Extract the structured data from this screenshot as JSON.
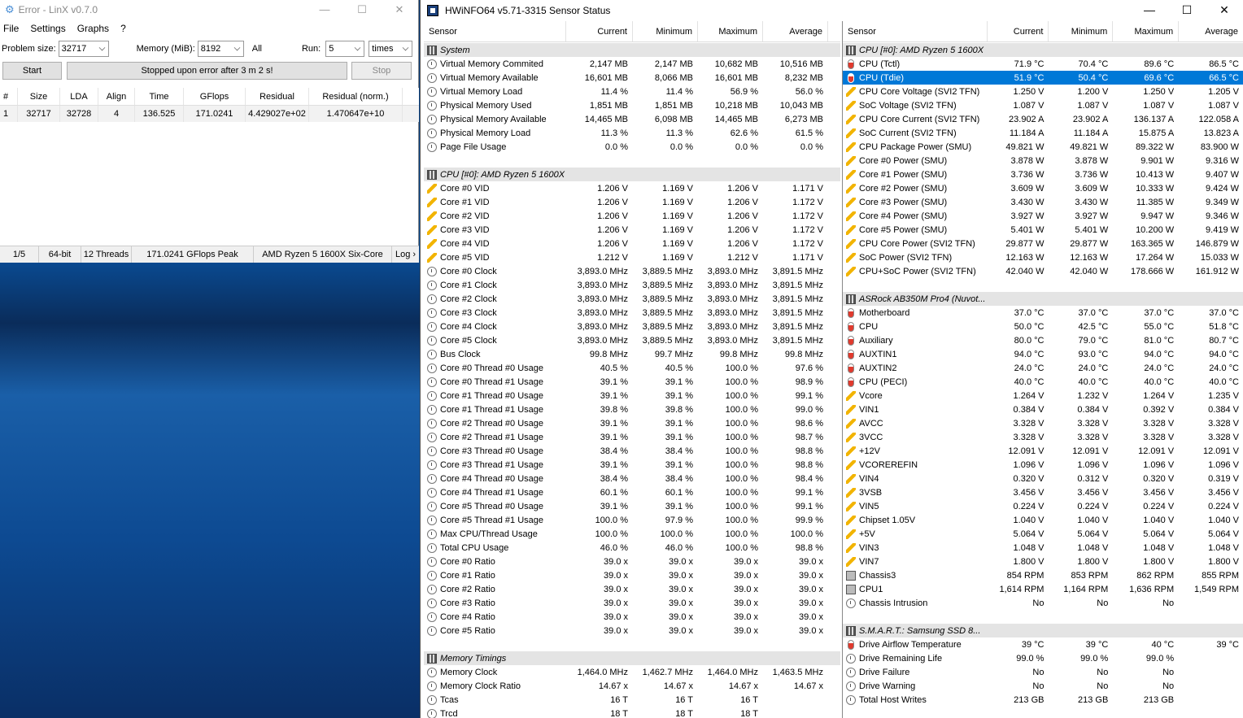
{
  "linx": {
    "title": "Error - LinX v0.7.0",
    "menu": [
      "File",
      "Settings",
      "Graphs",
      "?"
    ],
    "problem_size_label": "Problem size:",
    "problem_size_value": "32717",
    "memory_label": "Memory (MiB):",
    "memory_value": "8192",
    "all_label": "All",
    "run_label": "Run:",
    "run_value": "5",
    "run_unit": "times",
    "start_label": "Start",
    "status_message": "Stopped upon error after 3 m 2 s!",
    "stop_label": "Stop",
    "columns": [
      "#",
      "Size",
      "LDA",
      "Align",
      "Time",
      "GFlops",
      "Residual",
      "Residual (norm.)"
    ],
    "rows": [
      [
        "1",
        "32717",
        "32728",
        "4",
        "136.525",
        "171.0241",
        "4.429027e+02",
        "1.470647e+10"
      ]
    ],
    "statusbar": [
      "1/5",
      "64-bit",
      "12 Threads",
      "171.0241 GFlops Peak",
      "AMD Ryzen 5 1600X Six-Core",
      "Log ›"
    ]
  },
  "hwinfo": {
    "title": "HWiNFO64 v5.71-3315 Sensor Status",
    "columns": [
      "Sensor",
      "Current",
      "Minimum",
      "Maximum",
      "Average"
    ],
    "left_rows": [
      {
        "t": "group",
        "icon": "grp",
        "name": "System"
      },
      {
        "icon": "clock",
        "name": "Virtual Memory Commited",
        "c": "2,147 MB",
        "mn": "2,147 MB",
        "mx": "10,682 MB",
        "av": "10,516 MB"
      },
      {
        "icon": "clock",
        "name": "Virtual Memory Available",
        "c": "16,601 MB",
        "mn": "8,066 MB",
        "mx": "16,601 MB",
        "av": "8,232 MB"
      },
      {
        "icon": "clock",
        "name": "Virtual Memory Load",
        "c": "11.4 %",
        "mn": "11.4 %",
        "mx": "56.9 %",
        "av": "56.0 %"
      },
      {
        "icon": "clock",
        "name": "Physical Memory Used",
        "c": "1,851 MB",
        "mn": "1,851 MB",
        "mx": "10,218 MB",
        "av": "10,043 MB"
      },
      {
        "icon": "clock",
        "name": "Physical Memory Available",
        "c": "14,465 MB",
        "mn": "6,098 MB",
        "mx": "14,465 MB",
        "av": "6,273 MB"
      },
      {
        "icon": "clock",
        "name": "Physical Memory Load",
        "c": "11.3 %",
        "mn": "11.3 %",
        "mx": "62.6 %",
        "av": "61.5 %"
      },
      {
        "icon": "clock",
        "name": "Page File Usage",
        "c": "0.0 %",
        "mn": "0.0 %",
        "mx": "0.0 %",
        "av": "0.0 %"
      },
      {
        "t": "blank"
      },
      {
        "t": "group",
        "icon": "grp",
        "name": "CPU [#0]: AMD Ryzen 5 1600X"
      },
      {
        "icon": "bolt",
        "name": "Core #0 VID",
        "c": "1.206 V",
        "mn": "1.169 V",
        "mx": "1.206 V",
        "av": "1.171 V"
      },
      {
        "icon": "bolt",
        "name": "Core #1 VID",
        "c": "1.206 V",
        "mn": "1.169 V",
        "mx": "1.206 V",
        "av": "1.172 V"
      },
      {
        "icon": "bolt",
        "name": "Core #2 VID",
        "c": "1.206 V",
        "mn": "1.169 V",
        "mx": "1.206 V",
        "av": "1.172 V"
      },
      {
        "icon": "bolt",
        "name": "Core #3 VID",
        "c": "1.206 V",
        "mn": "1.169 V",
        "mx": "1.206 V",
        "av": "1.172 V"
      },
      {
        "icon": "bolt",
        "name": "Core #4 VID",
        "c": "1.206 V",
        "mn": "1.169 V",
        "mx": "1.206 V",
        "av": "1.172 V"
      },
      {
        "icon": "bolt",
        "name": "Core #5 VID",
        "c": "1.212 V",
        "mn": "1.169 V",
        "mx": "1.212 V",
        "av": "1.171 V"
      },
      {
        "icon": "clock",
        "name": "Core #0 Clock",
        "c": "3,893.0 MHz",
        "mn": "3,889.5 MHz",
        "mx": "3,893.0 MHz",
        "av": "3,891.5 MHz"
      },
      {
        "icon": "clock",
        "name": "Core #1 Clock",
        "c": "3,893.0 MHz",
        "mn": "3,889.5 MHz",
        "mx": "3,893.0 MHz",
        "av": "3,891.5 MHz"
      },
      {
        "icon": "clock",
        "name": "Core #2 Clock",
        "c": "3,893.0 MHz",
        "mn": "3,889.5 MHz",
        "mx": "3,893.0 MHz",
        "av": "3,891.5 MHz"
      },
      {
        "icon": "clock",
        "name": "Core #3 Clock",
        "c": "3,893.0 MHz",
        "mn": "3,889.5 MHz",
        "mx": "3,893.0 MHz",
        "av": "3,891.5 MHz"
      },
      {
        "icon": "clock",
        "name": "Core #4 Clock",
        "c": "3,893.0 MHz",
        "mn": "3,889.5 MHz",
        "mx": "3,893.0 MHz",
        "av": "3,891.5 MHz"
      },
      {
        "icon": "clock",
        "name": "Core #5 Clock",
        "c": "3,893.0 MHz",
        "mn": "3,889.5 MHz",
        "mx": "3,893.0 MHz",
        "av": "3,891.5 MHz"
      },
      {
        "icon": "clock",
        "name": "Bus Clock",
        "c": "99.8 MHz",
        "mn": "99.7 MHz",
        "mx": "99.8 MHz",
        "av": "99.8 MHz"
      },
      {
        "icon": "clock",
        "name": "Core #0 Thread #0 Usage",
        "c": "40.5 %",
        "mn": "40.5 %",
        "mx": "100.0 %",
        "av": "97.6 %"
      },
      {
        "icon": "clock",
        "name": "Core #0 Thread #1 Usage",
        "c": "39.1 %",
        "mn": "39.1 %",
        "mx": "100.0 %",
        "av": "98.9 %"
      },
      {
        "icon": "clock",
        "name": "Core #1 Thread #0 Usage",
        "c": "39.1 %",
        "mn": "39.1 %",
        "mx": "100.0 %",
        "av": "99.1 %"
      },
      {
        "icon": "clock",
        "name": "Core #1 Thread #1 Usage",
        "c": "39.8 %",
        "mn": "39.8 %",
        "mx": "100.0 %",
        "av": "99.0 %"
      },
      {
        "icon": "clock",
        "name": "Core #2 Thread #0 Usage",
        "c": "39.1 %",
        "mn": "39.1 %",
        "mx": "100.0 %",
        "av": "98.6 %"
      },
      {
        "icon": "clock",
        "name": "Core #2 Thread #1 Usage",
        "c": "39.1 %",
        "mn": "39.1 %",
        "mx": "100.0 %",
        "av": "98.7 %"
      },
      {
        "icon": "clock",
        "name": "Core #3 Thread #0 Usage",
        "c": "38.4 %",
        "mn": "38.4 %",
        "mx": "100.0 %",
        "av": "98.8 %"
      },
      {
        "icon": "clock",
        "name": "Core #3 Thread #1 Usage",
        "c": "39.1 %",
        "mn": "39.1 %",
        "mx": "100.0 %",
        "av": "98.8 %"
      },
      {
        "icon": "clock",
        "name": "Core #4 Thread #0 Usage",
        "c": "38.4 %",
        "mn": "38.4 %",
        "mx": "100.0 %",
        "av": "98.4 %"
      },
      {
        "icon": "clock",
        "name": "Core #4 Thread #1 Usage",
        "c": "60.1 %",
        "mn": "60.1 %",
        "mx": "100.0 %",
        "av": "99.1 %"
      },
      {
        "icon": "clock",
        "name": "Core #5 Thread #0 Usage",
        "c": "39.1 %",
        "mn": "39.1 %",
        "mx": "100.0 %",
        "av": "99.1 %"
      },
      {
        "icon": "clock",
        "name": "Core #5 Thread #1 Usage",
        "c": "100.0 %",
        "mn": "97.9 %",
        "mx": "100.0 %",
        "av": "99.9 %"
      },
      {
        "icon": "clock",
        "name": "Max CPU/Thread Usage",
        "c": "100.0 %",
        "mn": "100.0 %",
        "mx": "100.0 %",
        "av": "100.0 %"
      },
      {
        "icon": "clock",
        "name": "Total CPU Usage",
        "c": "46.0 %",
        "mn": "46.0 %",
        "mx": "100.0 %",
        "av": "98.8 %"
      },
      {
        "icon": "clock",
        "name": "Core #0 Ratio",
        "c": "39.0 x",
        "mn": "39.0 x",
        "mx": "39.0 x",
        "av": "39.0 x"
      },
      {
        "icon": "clock",
        "name": "Core #1 Ratio",
        "c": "39.0 x",
        "mn": "39.0 x",
        "mx": "39.0 x",
        "av": "39.0 x"
      },
      {
        "icon": "clock",
        "name": "Core #2 Ratio",
        "c": "39.0 x",
        "mn": "39.0 x",
        "mx": "39.0 x",
        "av": "39.0 x"
      },
      {
        "icon": "clock",
        "name": "Core #3 Ratio",
        "c": "39.0 x",
        "mn": "39.0 x",
        "mx": "39.0 x",
        "av": "39.0 x"
      },
      {
        "icon": "clock",
        "name": "Core #4 Ratio",
        "c": "39.0 x",
        "mn": "39.0 x",
        "mx": "39.0 x",
        "av": "39.0 x"
      },
      {
        "icon": "clock",
        "name": "Core #5 Ratio",
        "c": "39.0 x",
        "mn": "39.0 x",
        "mx": "39.0 x",
        "av": "39.0 x"
      },
      {
        "t": "blank"
      },
      {
        "t": "group",
        "icon": "grp",
        "name": "Memory Timings"
      },
      {
        "icon": "clock",
        "name": "Memory Clock",
        "c": "1,464.0 MHz",
        "mn": "1,462.7 MHz",
        "mx": "1,464.0 MHz",
        "av": "1,463.5 MHz"
      },
      {
        "icon": "clock",
        "name": "Memory Clock Ratio",
        "c": "14.67 x",
        "mn": "14.67 x",
        "mx": "14.67 x",
        "av": "14.67 x"
      },
      {
        "icon": "clock",
        "name": "Tcas",
        "c": "16 T",
        "mn": "16 T",
        "mx": "16 T",
        "av": ""
      },
      {
        "icon": "clock",
        "name": "Trcd",
        "c": "18 T",
        "mn": "18 T",
        "mx": "18 T",
        "av": ""
      }
    ],
    "right_rows": [
      {
        "t": "group",
        "icon": "grp",
        "name": "CPU [#0]: AMD Ryzen 5 1600X"
      },
      {
        "icon": "temp",
        "name": "CPU (Tctl)",
        "c": "71.9 °C",
        "mn": "70.4 °C",
        "mx": "89.6 °C",
        "av": "86.5 °C"
      },
      {
        "icon": "temp",
        "name": "CPU (Tdie)",
        "c": "51.9 °C",
        "mn": "50.4 °C",
        "mx": "69.6 °C",
        "av": "66.5 °C",
        "sel": true
      },
      {
        "icon": "bolt",
        "name": "CPU Core Voltage (SVI2 TFN)",
        "c": "1.250 V",
        "mn": "1.200 V",
        "mx": "1.250 V",
        "av": "1.205 V"
      },
      {
        "icon": "bolt",
        "name": "SoC Voltage (SVI2 TFN)",
        "c": "1.087 V",
        "mn": "1.087 V",
        "mx": "1.087 V",
        "av": "1.087 V"
      },
      {
        "icon": "bolt",
        "name": "CPU Core Current (SVI2 TFN)",
        "c": "23.902 A",
        "mn": "23.902 A",
        "mx": "136.137 A",
        "av": "122.058 A"
      },
      {
        "icon": "bolt",
        "name": "SoC Current (SVI2 TFN)",
        "c": "11.184 A",
        "mn": "11.184 A",
        "mx": "15.875 A",
        "av": "13.823 A"
      },
      {
        "icon": "bolt",
        "name": "CPU Package Power (SMU)",
        "c": "49.821 W",
        "mn": "49.821 W",
        "mx": "89.322 W",
        "av": "83.900 W"
      },
      {
        "icon": "bolt",
        "name": "Core #0 Power (SMU)",
        "c": "3.878 W",
        "mn": "3.878 W",
        "mx": "9.901 W",
        "av": "9.316 W"
      },
      {
        "icon": "bolt",
        "name": "Core #1 Power (SMU)",
        "c": "3.736 W",
        "mn": "3.736 W",
        "mx": "10.413 W",
        "av": "9.407 W"
      },
      {
        "icon": "bolt",
        "name": "Core #2 Power (SMU)",
        "c": "3.609 W",
        "mn": "3.609 W",
        "mx": "10.333 W",
        "av": "9.424 W"
      },
      {
        "icon": "bolt",
        "name": "Core #3 Power (SMU)",
        "c": "3.430 W",
        "mn": "3.430 W",
        "mx": "11.385 W",
        "av": "9.349 W"
      },
      {
        "icon": "bolt",
        "name": "Core #4 Power (SMU)",
        "c": "3.927 W",
        "mn": "3.927 W",
        "mx": "9.947 W",
        "av": "9.346 W"
      },
      {
        "icon": "bolt",
        "name": "Core #5 Power (SMU)",
        "c": "5.401 W",
        "mn": "5.401 W",
        "mx": "10.200 W",
        "av": "9.419 W"
      },
      {
        "icon": "bolt",
        "name": "CPU Core Power (SVI2 TFN)",
        "c": "29.877 W",
        "mn": "29.877 W",
        "mx": "163.365 W",
        "av": "146.879 W"
      },
      {
        "icon": "bolt",
        "name": "SoC Power (SVI2 TFN)",
        "c": "12.163 W",
        "mn": "12.163 W",
        "mx": "17.264 W",
        "av": "15.033 W"
      },
      {
        "icon": "bolt",
        "name": "CPU+SoC Power (SVI2 TFN)",
        "c": "42.040 W",
        "mn": "42.040 W",
        "mx": "178.666 W",
        "av": "161.912 W"
      },
      {
        "t": "blank"
      },
      {
        "t": "group",
        "icon": "grp",
        "name": "ASRock AB350M Pro4 (Nuvot..."
      },
      {
        "icon": "temp",
        "name": "Motherboard",
        "c": "37.0 °C",
        "mn": "37.0 °C",
        "mx": "37.0 °C",
        "av": "37.0 °C"
      },
      {
        "icon": "temp",
        "name": "CPU",
        "c": "50.0 °C",
        "mn": "42.5 °C",
        "mx": "55.0 °C",
        "av": "51.8 °C"
      },
      {
        "icon": "temp",
        "name": "Auxiliary",
        "c": "80.0 °C",
        "mn": "79.0 °C",
        "mx": "81.0 °C",
        "av": "80.7 °C"
      },
      {
        "icon": "temp",
        "name": "AUXTIN1",
        "c": "94.0 °C",
        "mn": "93.0 °C",
        "mx": "94.0 °C",
        "av": "94.0 °C"
      },
      {
        "icon": "temp",
        "name": "AUXTIN2",
        "c": "24.0 °C",
        "mn": "24.0 °C",
        "mx": "24.0 °C",
        "av": "24.0 °C"
      },
      {
        "icon": "temp",
        "name": "CPU (PECI)",
        "c": "40.0 °C",
        "mn": "40.0 °C",
        "mx": "40.0 °C",
        "av": "40.0 °C"
      },
      {
        "icon": "bolt",
        "name": "Vcore",
        "c": "1.264 V",
        "mn": "1.232 V",
        "mx": "1.264 V",
        "av": "1.235 V"
      },
      {
        "icon": "bolt",
        "name": "VIN1",
        "c": "0.384 V",
        "mn": "0.384 V",
        "mx": "0.392 V",
        "av": "0.384 V"
      },
      {
        "icon": "bolt",
        "name": "AVCC",
        "c": "3.328 V",
        "mn": "3.328 V",
        "mx": "3.328 V",
        "av": "3.328 V"
      },
      {
        "icon": "bolt",
        "name": "3VCC",
        "c": "3.328 V",
        "mn": "3.328 V",
        "mx": "3.328 V",
        "av": "3.328 V"
      },
      {
        "icon": "bolt",
        "name": "+12V",
        "c": "12.091 V",
        "mn": "12.091 V",
        "mx": "12.091 V",
        "av": "12.091 V"
      },
      {
        "icon": "bolt",
        "name": "VCOREREFIN",
        "c": "1.096 V",
        "mn": "1.096 V",
        "mx": "1.096 V",
        "av": "1.096 V"
      },
      {
        "icon": "bolt",
        "name": "VIN4",
        "c": "0.320 V",
        "mn": "0.312 V",
        "mx": "0.320 V",
        "av": "0.319 V"
      },
      {
        "icon": "bolt",
        "name": "3VSB",
        "c": "3.456 V",
        "mn": "3.456 V",
        "mx": "3.456 V",
        "av": "3.456 V"
      },
      {
        "icon": "bolt",
        "name": "VIN5",
        "c": "0.224 V",
        "mn": "0.224 V",
        "mx": "0.224 V",
        "av": "0.224 V"
      },
      {
        "icon": "bolt",
        "name": "Chipset 1.05V",
        "c": "1.040 V",
        "mn": "1.040 V",
        "mx": "1.040 V",
        "av": "1.040 V"
      },
      {
        "icon": "bolt",
        "name": "+5V",
        "c": "5.064 V",
        "mn": "5.064 V",
        "mx": "5.064 V",
        "av": "5.064 V"
      },
      {
        "icon": "bolt",
        "name": "VIN3",
        "c": "1.048 V",
        "mn": "1.048 V",
        "mx": "1.048 V",
        "av": "1.048 V"
      },
      {
        "icon": "bolt",
        "name": "VIN7",
        "c": "1.800 V",
        "mn": "1.800 V",
        "mx": "1.800 V",
        "av": "1.800 V"
      },
      {
        "icon": "fan",
        "name": "Chassis3",
        "c": "854 RPM",
        "mn": "853 RPM",
        "mx": "862 RPM",
        "av": "855 RPM"
      },
      {
        "icon": "fan",
        "name": "CPU1",
        "c": "1,614 RPM",
        "mn": "1,164 RPM",
        "mx": "1,636 RPM",
        "av": "1,549 RPM"
      },
      {
        "icon": "clock",
        "name": "Chassis Intrusion",
        "c": "No",
        "mn": "No",
        "mx": "No",
        "av": ""
      },
      {
        "t": "blank"
      },
      {
        "t": "group",
        "icon": "grp",
        "name": "S.M.A.R.T.: Samsung SSD 8..."
      },
      {
        "icon": "temp",
        "name": "Drive Airflow Temperature",
        "c": "39 °C",
        "mn": "39 °C",
        "mx": "40 °C",
        "av": "39 °C"
      },
      {
        "icon": "clock",
        "name": "Drive Remaining Life",
        "c": "99.0 %",
        "mn": "99.0 %",
        "mx": "99.0 %",
        "av": ""
      },
      {
        "icon": "clock",
        "name": "Drive Failure",
        "c": "No",
        "mn": "No",
        "mx": "No",
        "av": ""
      },
      {
        "icon": "clock",
        "name": "Drive Warning",
        "c": "No",
        "mn": "No",
        "mx": "No",
        "av": ""
      },
      {
        "icon": "clock",
        "name": "Total Host Writes",
        "c": "213 GB",
        "mn": "213 GB",
        "mx": "213 GB",
        "av": ""
      }
    ]
  }
}
